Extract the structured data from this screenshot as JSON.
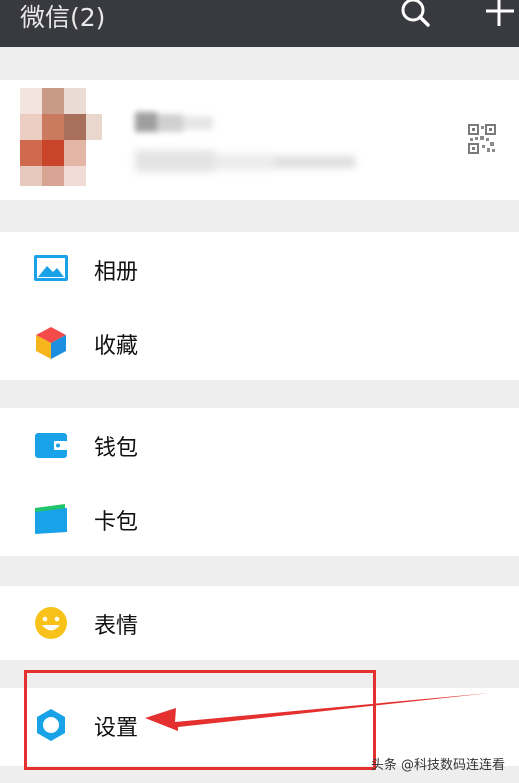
{
  "header": {
    "title": "微信(2)",
    "search_icon": "search-icon",
    "add_icon": "plus-icon"
  },
  "profile": {
    "avatar": "blurred-avatar",
    "qr_icon": "qr-code-icon"
  },
  "menu": {
    "album": {
      "label": "相册",
      "icon": "image-icon"
    },
    "favorites": {
      "label": "收藏",
      "icon": "cube-icon"
    },
    "wallet": {
      "label": "钱包",
      "icon": "wallet-icon"
    },
    "cards": {
      "label": "卡包",
      "icon": "card-icon"
    },
    "stickers": {
      "label": "表情",
      "icon": "smiley-icon"
    },
    "settings": {
      "label": "设置",
      "icon": "gear-icon"
    }
  },
  "annotation": {
    "highlight_color": "#e53030"
  },
  "watermark": "头条 @科技数码连连看",
  "colors": {
    "topbar": "#393a3f",
    "background": "#eeeeee",
    "accent_blue": "#19a2e7"
  }
}
